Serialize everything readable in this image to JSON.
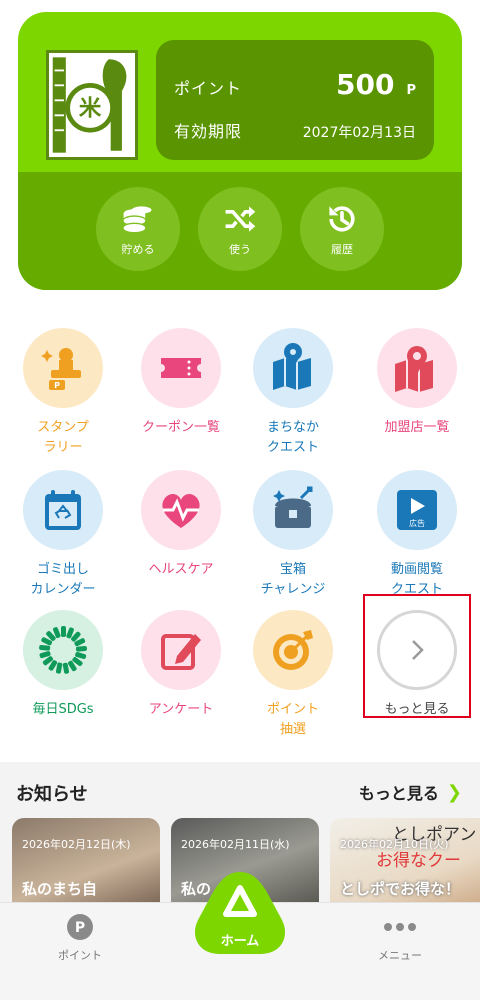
{
  "card": {
    "point_label": "ポイント",
    "point_value": "500",
    "point_unit": "P",
    "expiry_label": "有効期限",
    "expiry_value": "2027年02月13日",
    "actions": [
      {
        "label": "貯める",
        "icon": "coins-icon"
      },
      {
        "label": "使う",
        "icon": "shuffle-icon"
      },
      {
        "label": "履歴",
        "icon": "history-icon"
      }
    ]
  },
  "grid": [
    {
      "label": "スタンプ\nラリー",
      "icon": "stamp-icon",
      "color": "#f0a020"
    },
    {
      "label": "クーポン一覧",
      "icon": "coupon-icon",
      "color": "#e8467c"
    },
    {
      "label": "まちなか\nクエスト",
      "icon": "map-key-icon",
      "color": "#1a78b8"
    },
    {
      "label": "加盟店一覧",
      "icon": "map-pin-icon",
      "color": "#e8467c"
    },
    {
      "label": "ゴミ出し\nカレンダー",
      "icon": "recycle-calendar-icon",
      "color": "#1a78b8"
    },
    {
      "label": "ヘルスケア",
      "icon": "heart-icon",
      "color": "#e8467c"
    },
    {
      "label": "宝箱\nチャレンジ",
      "icon": "treasure-icon",
      "color": "#1a78b8"
    },
    {
      "label": "動画閲覧\nクエスト",
      "icon": "video-ad-icon",
      "color": "#1a78b8",
      "badge": "広告"
    },
    {
      "label": "毎日SDGs",
      "icon": "sdgs-icon",
      "color": "#0f9a5a"
    },
    {
      "label": "アンケート",
      "icon": "pencil-icon",
      "color": "#e8467c"
    },
    {
      "label": "ポイント\n抽選",
      "icon": "target-icon",
      "color": "#f0a020"
    },
    {
      "label": "もっと見る",
      "icon": "chevron-right-icon",
      "color": "#444444"
    }
  ],
  "news": {
    "title": "お知らせ",
    "more": "もっと見る",
    "items": [
      {
        "date": "2026年02月12日(木)",
        "title": "私のまち自"
      },
      {
        "date": "2026年02月11日(水)",
        "title": "私の"
      },
      {
        "date": "2026年02月10日(火)",
        "title": "としポでお得な！"
      }
    ],
    "overlay_text": [
      "としポアン",
      "お得なクー"
    ]
  },
  "nav": {
    "point": "ポイント",
    "home": "ホーム",
    "menu": "メニュー",
    "point_badge": "P"
  },
  "colors": {
    "brand_green": "#7ed600",
    "dark_green": "#5a9400",
    "highlight_red": "#e0001e"
  }
}
